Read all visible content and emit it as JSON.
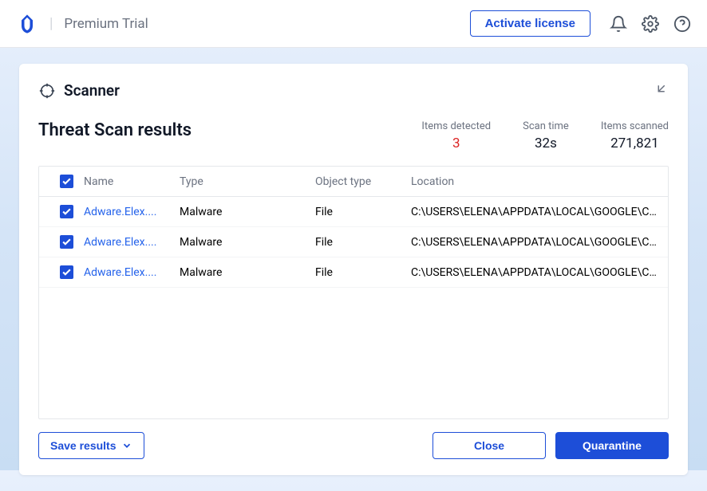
{
  "topbar": {
    "brand": "Premium Trial",
    "activate_label": "Activate license"
  },
  "card": {
    "header_title": "Scanner",
    "results_title": "Threat Scan results"
  },
  "stats": {
    "detected_label": "Items detected",
    "detected_value": "3",
    "time_label": "Scan time",
    "time_value": "32s",
    "scanned_label": "Items scanned",
    "scanned_value": "271,821"
  },
  "columns": {
    "name": "Name",
    "type": "Type",
    "object_type": "Object type",
    "location": "Location"
  },
  "rows": [
    {
      "name": "Adware.Elex....",
      "type": "Malware",
      "object_type": "File",
      "location": "C:\\USERS\\ELENA\\APPDATA\\LOCAL\\GOOGLE\\CHRO..."
    },
    {
      "name": "Adware.Elex....",
      "type": "Malware",
      "object_type": "File",
      "location": "C:\\USERS\\ELENA\\APPDATA\\LOCAL\\GOOGLE\\CHRO..."
    },
    {
      "name": "Adware.Elex....",
      "type": "Malware",
      "object_type": "File",
      "location": "C:\\USERS\\ELENA\\APPDATA\\LOCAL\\GOOGLE\\CHRO..."
    }
  ],
  "footer": {
    "save_label": "Save results",
    "close_label": "Close",
    "quarantine_label": "Quarantine"
  },
  "colors": {
    "primary": "#1d4ed8",
    "danger": "#dc2626"
  }
}
